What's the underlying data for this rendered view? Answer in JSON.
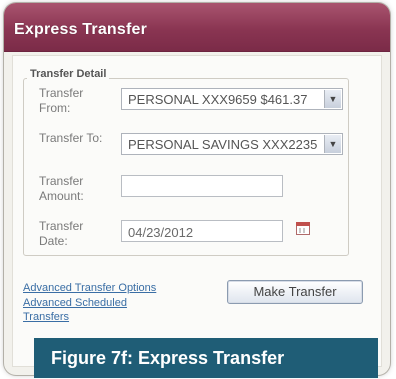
{
  "window": {
    "title": "Express Transfer"
  },
  "form": {
    "section_title": "Transfer Detail",
    "from": {
      "label": "Transfer From:",
      "value": "PERSONAL XXX9659 $461.37"
    },
    "to": {
      "label": "Transfer To:",
      "value": "PERSONAL SAVINGS XXX2235"
    },
    "amount": {
      "label": "Transfer Amount:",
      "value": ""
    },
    "date": {
      "label": "Transfer Date:",
      "value": "04/23/2012"
    }
  },
  "links": {
    "advanced_options": "Advanced Transfer Options",
    "advanced_scheduled": "Advanced Scheduled Transfers"
  },
  "buttons": {
    "make_transfer": "Make Transfer"
  },
  "caption": "Figure 7f: Express Transfer",
  "icons": {
    "select_arrow": "chevron-down-icon",
    "calendar": "calendar-icon"
  },
  "colors": {
    "titlebar": "#8a3552",
    "caption_bg": "#1f5d76",
    "link": "#3a6ea5"
  }
}
